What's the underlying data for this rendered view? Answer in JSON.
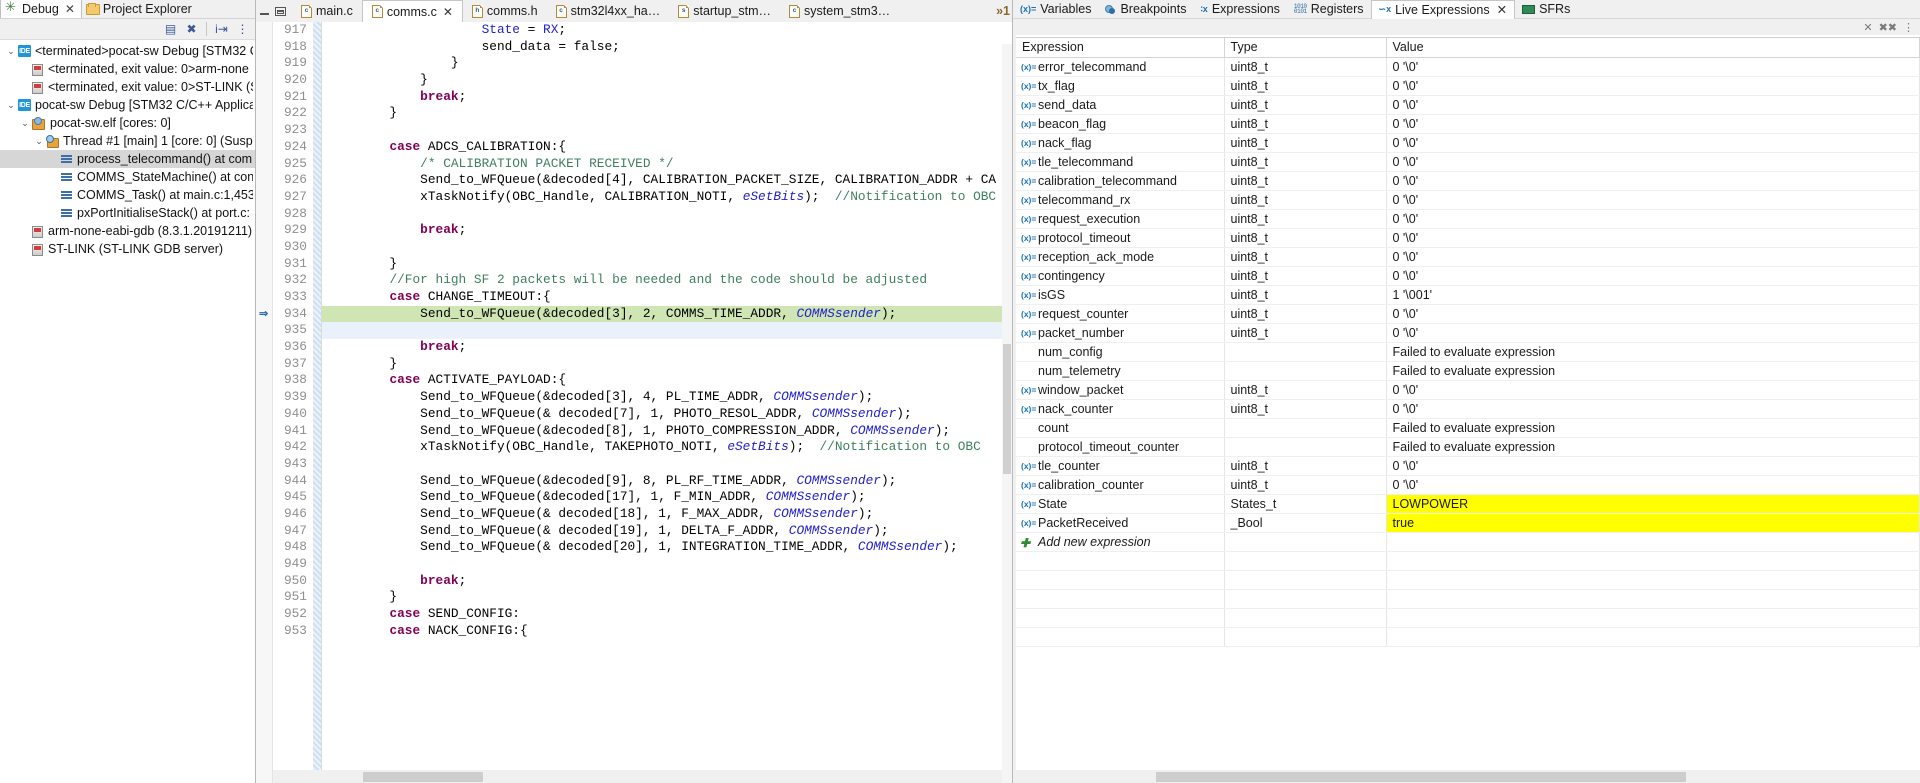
{
  "debug_view": {
    "tabs": [
      {
        "label": "Debug",
        "icon": "bug-icon",
        "active": true,
        "closable": true
      },
      {
        "label": "Project Explorer",
        "icon": "folder-icon",
        "active": false,
        "closable": false
      }
    ],
    "toolbar": [
      "collapse-all-icon",
      "disconnect-icon",
      "step-into-icon",
      "menu-icon"
    ],
    "tree": [
      {
        "indent": 0,
        "twisty": "v",
        "icon": "ide-icon",
        "label": "<terminated>pocat-sw Debug [STM32 C",
        "selected": false
      },
      {
        "indent": 1,
        "twisty": "",
        "icon": "process-icon",
        "label": "<terminated, exit value: 0>arm-none",
        "selected": false
      },
      {
        "indent": 1,
        "twisty": "",
        "icon": "process-icon",
        "label": "<terminated, exit value: 0>ST-LINK (S",
        "selected": false
      },
      {
        "indent": 0,
        "twisty": "v",
        "icon": "ide-icon",
        "label": "pocat-sw Debug [STM32 C/C++ Applica",
        "selected": false
      },
      {
        "indent": 1,
        "twisty": "v",
        "icon": "elf-icon",
        "label": "pocat-sw.elf [cores: 0]",
        "selected": false
      },
      {
        "indent": 2,
        "twisty": "v",
        "icon": "thread-icon",
        "label": "Thread #1 [main] 1 [core: 0] (Susp",
        "selected": false
      },
      {
        "indent": 3,
        "twisty": "",
        "icon": "stack-icon",
        "label": "process_telecommand() at com",
        "selected": true
      },
      {
        "indent": 3,
        "twisty": "",
        "icon": "stack-icon",
        "label": "COMMS_StateMachine() at con",
        "selected": false
      },
      {
        "indent": 3,
        "twisty": "",
        "icon": "stack-icon",
        "label": "COMMS_Task() at main.c:1,453",
        "selected": false
      },
      {
        "indent": 3,
        "twisty": "",
        "icon": "stack-icon",
        "label": "pxPortInitialiseStack() at port.c:",
        "selected": false
      },
      {
        "indent": 1,
        "twisty": "",
        "icon": "process-icon",
        "label": "arm-none-eabi-gdb (8.3.1.20191211)",
        "selected": false
      },
      {
        "indent": 1,
        "twisty": "",
        "icon": "process-icon",
        "label": "ST-LINK (ST-LINK GDB server)",
        "selected": false
      }
    ]
  },
  "editor": {
    "tabs": [
      {
        "label": "main.c",
        "type": "c",
        "active": false,
        "closable": false
      },
      {
        "label": "comms.c",
        "type": "c",
        "active": true,
        "closable": true
      },
      {
        "label": "comms.h",
        "type": "h",
        "active": false,
        "closable": false
      },
      {
        "label": "stm32l4xx_ha…",
        "type": "c",
        "active": false,
        "closable": false
      },
      {
        "label": "startup_stm…",
        "type": "s",
        "active": false,
        "closable": false
      },
      {
        "label": "system_stm3…",
        "type": "c",
        "active": false,
        "closable": false
      }
    ],
    "overflow_indicator": "»1",
    "window_buttons": [
      "minimize",
      "restore"
    ],
    "first_line": 917,
    "current_line": 934,
    "lines": [
      {
        "n": 917,
        "html": "                    <span class=\"bl\">State</span> = <span class=\"bl\">RX</span>;",
        "style": ""
      },
      {
        "n": 918,
        "html": "                    send_data = false;",
        "style": ""
      },
      {
        "n": 919,
        "html": "                }",
        "style": ""
      },
      {
        "n": 920,
        "html": "            }",
        "style": ""
      },
      {
        "n": 921,
        "html": "            <span class=\"kw\">break</span>;",
        "style": ""
      },
      {
        "n": 922,
        "html": "        }",
        "style": ""
      },
      {
        "n": 923,
        "html": "",
        "style": ""
      },
      {
        "n": 924,
        "html": "        <span class=\"kw\">case</span> ADCS_CALIBRATION:{",
        "style": ""
      },
      {
        "n": 925,
        "html": "            <span class=\"cm\">/* CALIBRATION PACKET RECEIVED */</span>",
        "style": ""
      },
      {
        "n": 926,
        "html": "            Send_to_WFQueue(&amp;decoded[4], CALIBRATION_PACKET_SIZE, CALIBRATION_ADDR + CA",
        "style": ""
      },
      {
        "n": 927,
        "html": "            xTaskNotify(OBC_Handle, CALIBRATION_NOTI, <span class=\"it\">eSetBits</span>);  <span class=\"cm\">//Notification to OBC</span>",
        "style": ""
      },
      {
        "n": 928,
        "html": "",
        "style": ""
      },
      {
        "n": 929,
        "html": "            <span class=\"kw\">break</span>;",
        "style": ""
      },
      {
        "n": 930,
        "html": "",
        "style": ""
      },
      {
        "n": 931,
        "html": "        }",
        "style": ""
      },
      {
        "n": 932,
        "html": "        <span class=\"cm\">//For high SF 2 packets will be needed and the code should be adjusted</span>",
        "style": ""
      },
      {
        "n": 933,
        "html": "        <span class=\"kw\">case</span> CHANGE_TIMEOUT:{",
        "style": ""
      },
      {
        "n": 934,
        "html": "            Send_to_WFQueue(&amp;decoded[3], 2, COMMS_TIME_ADDR, <span class=\"it\">COMMSsender</span>);",
        "style": "hl"
      },
      {
        "n": 935,
        "html": "",
        "style": "curline"
      },
      {
        "n": 936,
        "html": "            <span class=\"kw\">break</span>;",
        "style": ""
      },
      {
        "n": 937,
        "html": "        }",
        "style": ""
      },
      {
        "n": 938,
        "html": "        <span class=\"kw\">case</span> ACTIVATE_PAYLOAD:{",
        "style": ""
      },
      {
        "n": 939,
        "html": "            Send_to_WFQueue(&amp;decoded[3], 4, PL_TIME_ADDR, <span class=\"it\">COMMSsender</span>);",
        "style": ""
      },
      {
        "n": 940,
        "html": "            Send_to_WFQueue(&amp; decoded[7], 1, PHOTO_RESOL_ADDR, <span class=\"it\">COMMSsender</span>);",
        "style": ""
      },
      {
        "n": 941,
        "html": "            Send_to_WFQueue(&amp;decoded[8], 1, PHOTO_COMPRESSION_ADDR, <span class=\"it\">COMMSsender</span>);",
        "style": ""
      },
      {
        "n": 942,
        "html": "            xTaskNotify(OBC_Handle, TAKEPHOTO_NOTI, <span class=\"it\">eSetBits</span>);  <span class=\"cm\">//Notification to OBC</span>",
        "style": ""
      },
      {
        "n": 943,
        "html": "",
        "style": ""
      },
      {
        "n": 944,
        "html": "            Send_to_WFQueue(&amp;decoded[9], 8, PL_RF_TIME_ADDR, <span class=\"it\">COMMSsender</span>);",
        "style": ""
      },
      {
        "n": 945,
        "html": "            Send_to_WFQueue(&amp;decoded[17], 1, F_MIN_ADDR, <span class=\"it\">COMMSsender</span>);",
        "style": ""
      },
      {
        "n": 946,
        "html": "            Send_to_WFQueue(&amp; decoded[18], 1, F_MAX_ADDR, <span class=\"it\">COMMSsender</span>);",
        "style": ""
      },
      {
        "n": 947,
        "html": "            Send_to_WFQueue(&amp; decoded[19], 1, DELTA_F_ADDR, <span class=\"it\">COMMSsender</span>);",
        "style": ""
      },
      {
        "n": 948,
        "html": "            Send_to_WFQueue(&amp; decoded[20], 1, INTEGRATION_TIME_ADDR, <span class=\"it\">COMMSsender</span>);",
        "style": ""
      },
      {
        "n": 949,
        "html": "",
        "style": ""
      },
      {
        "n": 950,
        "html": "            <span class=\"kw\">break</span>;",
        "style": ""
      },
      {
        "n": 951,
        "html": "        }",
        "style": ""
      },
      {
        "n": 952,
        "html": "        <span class=\"kw\">case</span> SEND_CONFIG:",
        "style": ""
      },
      {
        "n": 953,
        "html": "        <span class=\"kw\">case</span> NACK_CONFIG:{",
        "style": ""
      }
    ]
  },
  "expressions_view": {
    "tabs": [
      {
        "label": "Variables",
        "icon": "variables-icon",
        "active": false,
        "closable": false
      },
      {
        "label": "Breakpoints",
        "icon": "breakpoints-icon",
        "active": false,
        "closable": false
      },
      {
        "label": "Expressions",
        "icon": "expressions-icon",
        "active": false,
        "closable": false
      },
      {
        "label": "Registers",
        "icon": "registers-icon",
        "active": false,
        "closable": false
      },
      {
        "label": "Live Expressions",
        "icon": "live-expressions-icon",
        "active": true,
        "closable": true
      },
      {
        "label": "SFRs",
        "icon": "sfrs-icon",
        "active": false,
        "closable": false
      }
    ],
    "toolbar": [
      "remove-icon",
      "remove-all-icon",
      "view-menu-icon"
    ],
    "columns": [
      "Expression",
      "Type",
      "Value"
    ],
    "add_new_label": "Add new expression",
    "rows": [
      {
        "name": "error_telecommand",
        "type": "uint8_t",
        "value": "0 '\\0'",
        "has_icon": true,
        "highlight": false
      },
      {
        "name": "tx_flag",
        "type": "uint8_t",
        "value": "0 '\\0'",
        "has_icon": true,
        "highlight": false
      },
      {
        "name": "send_data",
        "type": "uint8_t",
        "value": "0 '\\0'",
        "has_icon": true,
        "highlight": false
      },
      {
        "name": "beacon_flag",
        "type": "uint8_t",
        "value": "0 '\\0'",
        "has_icon": true,
        "highlight": false
      },
      {
        "name": "nack_flag",
        "type": "uint8_t",
        "value": "0 '\\0'",
        "has_icon": true,
        "highlight": false
      },
      {
        "name": "tle_telecommand",
        "type": "uint8_t",
        "value": "0 '\\0'",
        "has_icon": true,
        "highlight": false
      },
      {
        "name": "calibration_telecommand",
        "type": "uint8_t",
        "value": "0 '\\0'",
        "has_icon": true,
        "highlight": false
      },
      {
        "name": "telecommand_rx",
        "type": "uint8_t",
        "value": "0 '\\0'",
        "has_icon": true,
        "highlight": false
      },
      {
        "name": "request_execution",
        "type": "uint8_t",
        "value": "0 '\\0'",
        "has_icon": true,
        "highlight": false
      },
      {
        "name": "protocol_timeout",
        "type": "uint8_t",
        "value": "0 '\\0'",
        "has_icon": true,
        "highlight": false
      },
      {
        "name": "reception_ack_mode",
        "type": "uint8_t",
        "value": "0 '\\0'",
        "has_icon": true,
        "highlight": false
      },
      {
        "name": "contingency",
        "type": "uint8_t",
        "value": "0 '\\0'",
        "has_icon": true,
        "highlight": false
      },
      {
        "name": "isGS",
        "type": "uint8_t",
        "value": "1 '\\001'",
        "has_icon": true,
        "highlight": false
      },
      {
        "name": "request_counter",
        "type": "uint8_t",
        "value": "0 '\\0'",
        "has_icon": true,
        "highlight": false
      },
      {
        "name": "packet_number",
        "type": "uint8_t",
        "value": "0 '\\0'",
        "has_icon": true,
        "highlight": false
      },
      {
        "name": "num_config",
        "type": "",
        "value": "Failed to evaluate expression",
        "has_icon": false,
        "highlight": false
      },
      {
        "name": "num_telemetry",
        "type": "",
        "value": "Failed to evaluate expression",
        "has_icon": false,
        "highlight": false
      },
      {
        "name": "window_packet",
        "type": "uint8_t",
        "value": "0 '\\0'",
        "has_icon": true,
        "highlight": false
      },
      {
        "name": "nack_counter",
        "type": "uint8_t",
        "value": "0 '\\0'",
        "has_icon": true,
        "highlight": false
      },
      {
        "name": "count",
        "type": "",
        "value": "Failed to evaluate expression",
        "has_icon": false,
        "highlight": false
      },
      {
        "name": "protocol_timeout_counter",
        "type": "",
        "value": "Failed to evaluate expression",
        "has_icon": false,
        "highlight": false
      },
      {
        "name": "tle_counter",
        "type": "uint8_t",
        "value": "0 '\\0'",
        "has_icon": true,
        "highlight": false
      },
      {
        "name": "calibration_counter",
        "type": "uint8_t",
        "value": "0 '\\0'",
        "has_icon": true,
        "highlight": false
      },
      {
        "name": "State",
        "type": "States_t",
        "value": "LOWPOWER",
        "has_icon": true,
        "highlight": true
      },
      {
        "name": "PacketReceived",
        "type": "_Bool",
        "value": "true",
        "has_icon": true,
        "highlight": true
      }
    ]
  },
  "colors": {
    "keyword": "#7f0055",
    "comment": "#3f7f5f",
    "italic_var": "#2222cc",
    "exec_line_highlight": "#cfe6b4",
    "value_highlight": "#ffff00",
    "selection": "#d6d6d6"
  }
}
